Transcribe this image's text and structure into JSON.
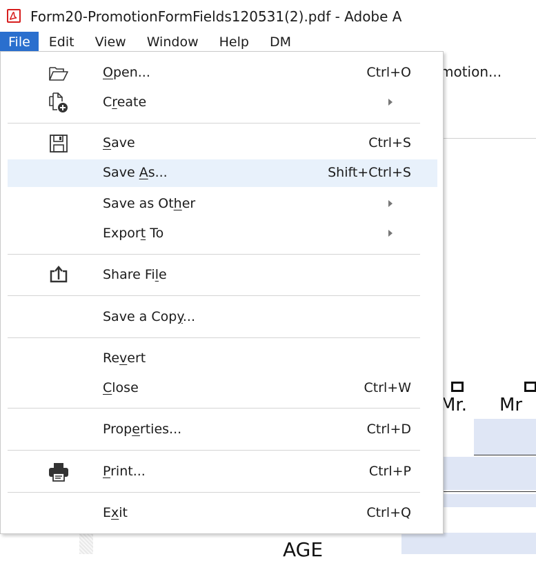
{
  "window": {
    "title": "Form20-PromotionFormFields120531(2).pdf - Adobe A"
  },
  "menubar": {
    "items": [
      {
        "label": "File",
        "active": true
      },
      {
        "label": "Edit"
      },
      {
        "label": "View"
      },
      {
        "label": "Window"
      },
      {
        "label": "Help"
      },
      {
        "label": "DM"
      }
    ]
  },
  "document": {
    "tab_text": "motion...",
    "salutations": [
      "Mr.",
      "Mr"
    ],
    "age_label": "AGE"
  },
  "file_menu": {
    "items": [
      {
        "label": "Open...",
        "underline": "O",
        "shortcut": "Ctrl+O",
        "icon": "folder-icon"
      },
      {
        "label": "Create",
        "underline": "r",
        "submenu": true,
        "icon": "create-pdf-icon"
      },
      {
        "label": "Save",
        "underline": "S",
        "shortcut": "Ctrl+S",
        "icon": "save-icon"
      },
      {
        "label": "Save As...",
        "underline": "A",
        "shortcut": "Shift+Ctrl+S",
        "highlighted": true
      },
      {
        "label": "Save as Other",
        "underline": "h",
        "submenu": true
      },
      {
        "label": "Export To",
        "underline": "t",
        "submenu": true
      },
      {
        "label": "Share File",
        "underline": "l",
        "icon": "share-icon"
      },
      {
        "label": "Save a Copy...",
        "underline": "y"
      },
      {
        "label": "Revert",
        "underline": "v"
      },
      {
        "label": "Close",
        "underline": "C",
        "shortcut": "Ctrl+W"
      },
      {
        "label": "Properties...",
        "underline": "e",
        "shortcut": "Ctrl+D"
      },
      {
        "label": "Print...",
        "underline": "P",
        "shortcut": "Ctrl+P",
        "icon": "printer-icon"
      },
      {
        "label": "Exit",
        "underline": "x",
        "shortcut": "Ctrl+Q"
      }
    ]
  },
  "colors": {
    "accent": "#2a6fce",
    "hover": "#e8f1fb",
    "app_icon_red": "#d71e1e",
    "form_field": "#dfe6f5"
  }
}
